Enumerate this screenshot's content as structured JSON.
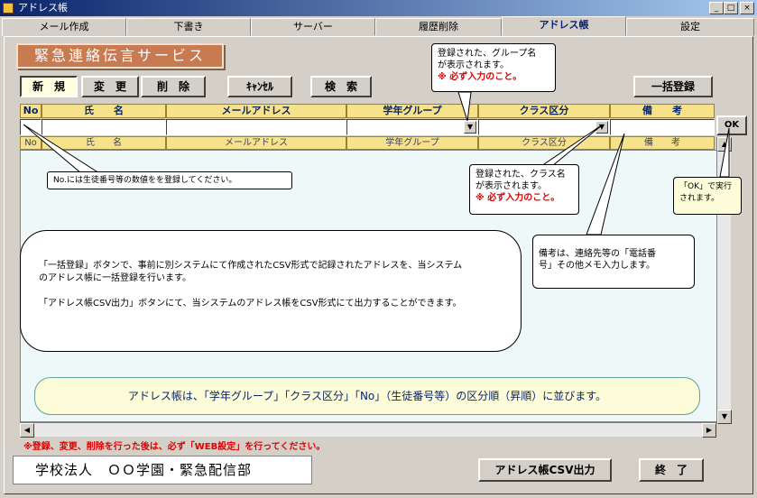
{
  "window": {
    "title": "アドレス帳",
    "min_icon": "minimize-icon",
    "max_icon": "maximize-icon",
    "close_icon": "close-icon"
  },
  "tabs": [
    {
      "label": "メール作成"
    },
    {
      "label": "下書き"
    },
    {
      "label": "サーバー"
    },
    {
      "label": "履歴削除"
    },
    {
      "label": "アドレス帳"
    },
    {
      "label": "設定"
    }
  ],
  "service_title": "緊急連絡伝言サービス",
  "buttons": {
    "new": "新　規",
    "edit": "変　更",
    "delete": "削　除",
    "cancel": "ｷｬﾝｾﾙ",
    "search": "検　索",
    "bulk": "一括登録",
    "ok": "OK",
    "csv_out": "アドレス帳CSV出力",
    "exit": "終　了"
  },
  "columns": {
    "no": "No",
    "name": "氏　　名",
    "mail": "メールアドレス",
    "grade": "学年グループ",
    "class": "クラス区分",
    "note": "備　　考"
  },
  "callouts": {
    "group_line1": "登録された、グループ名",
    "group_line2": "が表示されます。",
    "group_req": "※ 必ず入力のこと。",
    "no_hint": "No.には生徒番号等の数値をを登録してください。",
    "class_line1": "登録された、クラス名",
    "class_line2": "が表示されます。",
    "class_req": "※ 必ず入力のこと。",
    "ok_line1": "「OK」で実行",
    "ok_line2": "されます。",
    "note_line1": "備考は、連絡先等の「電話番",
    "note_line2": "号」その他メモ入力します。",
    "big_line1": "「一括登録」ボタンで、事前に別システムにて作成されたCSV形式で記録されたアドレスを、当システム",
    "big_line2": "のアドレス帳に一括登録を行います。",
    "big_line3": "「アドレス帳CSV出力」ボタンにて、当システムのアドレス帳をCSV形式にて出力することができます。",
    "sort_note": "アドレス帳は、「学年グループ」「クラス区分」「No」（生徒番号等）の区分順（昇順）に並びます。"
  },
  "warning": "※登録、変更、削除を行った後は、必ず「WEB設定」を行ってください。",
  "footer_name": "学校法人　ＯＯ学園・緊急配信部"
}
